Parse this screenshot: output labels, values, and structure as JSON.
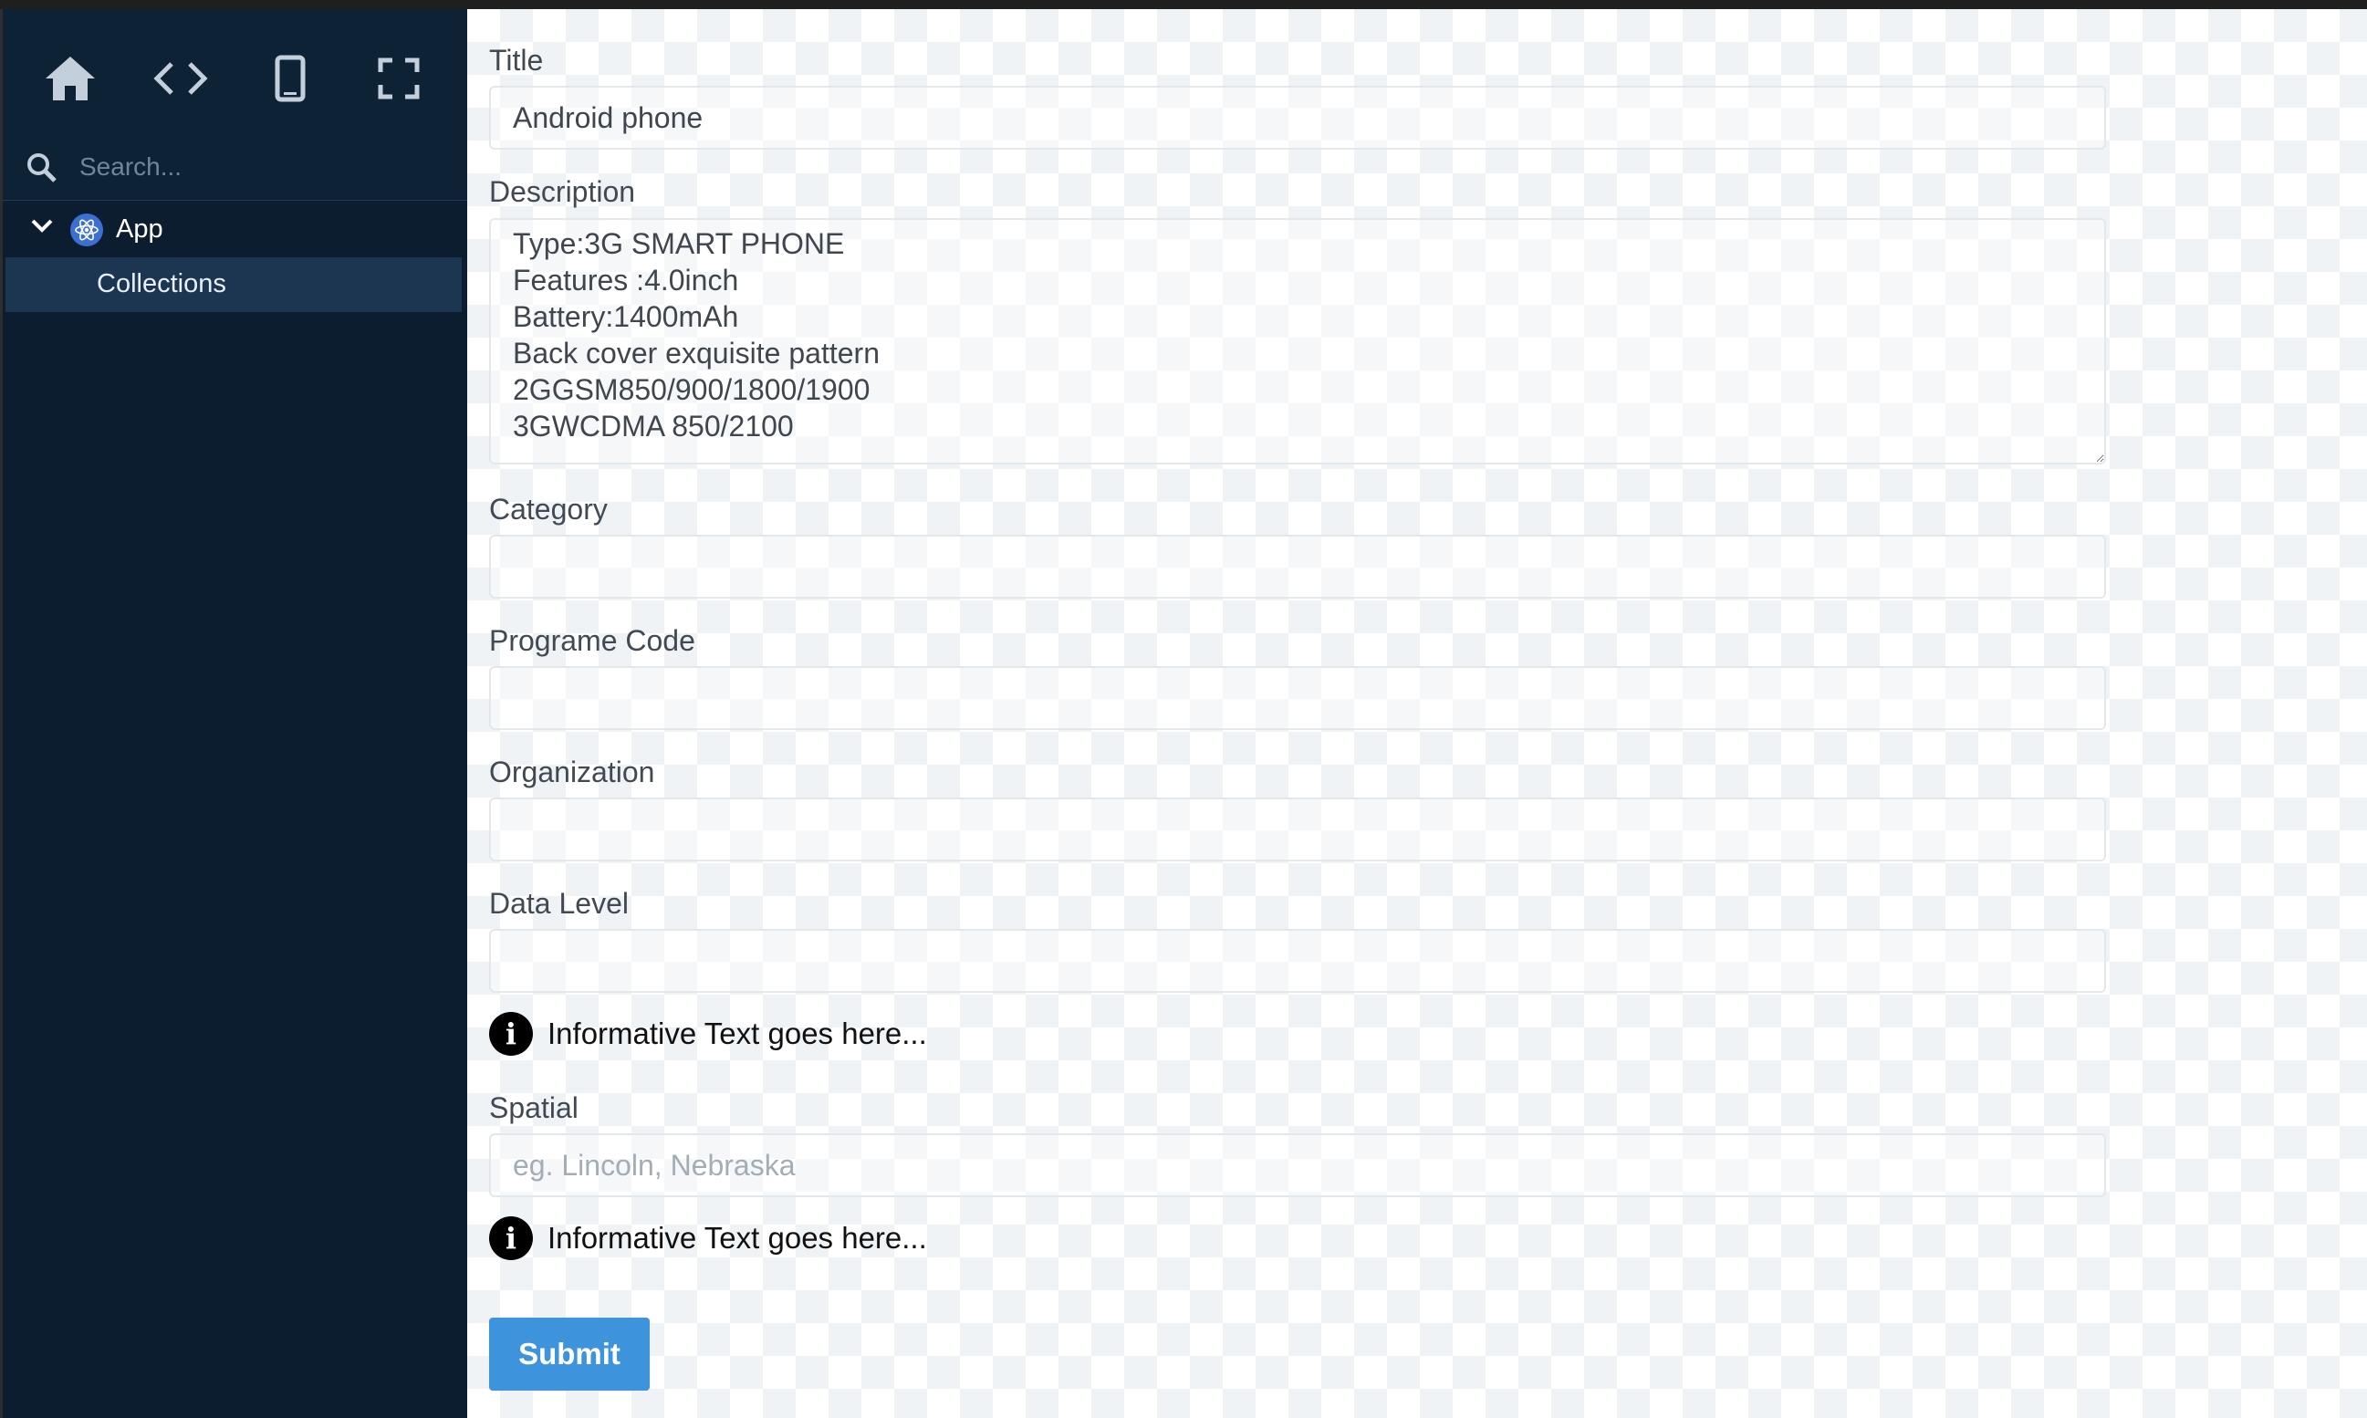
{
  "sidebar": {
    "toolbar": [
      {
        "icon": "home-icon"
      },
      {
        "icon": "code-icon"
      },
      {
        "icon": "mobile-device-icon"
      },
      {
        "icon": "fullscreen-icon"
      }
    ],
    "search_placeholder": "Search...",
    "tree": {
      "root_label": "App",
      "child_label": "Collections"
    }
  },
  "form": {
    "title": {
      "label": "Title",
      "value": "Android phone"
    },
    "description": {
      "label": "Description",
      "value": "Type:3G SMART PHONE\nFeatures :4.0inch\nBattery:1400mAh\nBack cover exquisite pattern\n2GGSM850/900/1800/1900\n3GWCDMA 850/2100"
    },
    "category": {
      "label": "Category",
      "value": ""
    },
    "program_code": {
      "label": "Programe Code",
      "value": ""
    },
    "organization": {
      "label": "Organization",
      "value": ""
    },
    "data_level": {
      "label": "Data Level",
      "value": ""
    },
    "info_text_1": "Informative Text goes here...",
    "spatial": {
      "label": "Spatial",
      "placeholder": "eg. Lincoln, Nebraska"
    },
    "info_text_2": "Informative Text goes here...",
    "submit_label": "Submit"
  },
  "colors": {
    "sidebar_bg": "#0c1d2f",
    "accent": "#3d93dc"
  }
}
